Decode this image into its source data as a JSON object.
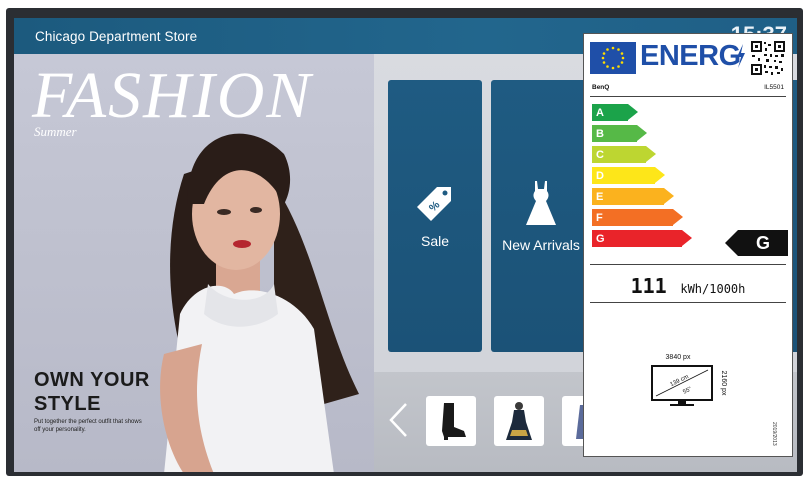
{
  "header": {
    "store_name": "Chicago Department Store",
    "clock": "15:37"
  },
  "hero": {
    "title": "FASHION",
    "subtitle": "Summer",
    "headline": "OWN YOUR STYLE",
    "description": "Put together the perfect outfit that shows off your personality."
  },
  "tiles": [
    {
      "label": "Sale",
      "icon": "price-tag-icon"
    },
    {
      "label": "New Arrivals",
      "icon": "dress-icon"
    }
  ],
  "thumbnails": [
    {
      "icon": "boot-icon"
    },
    {
      "icon": "dress-thumbnail-icon"
    },
    {
      "icon": "garment-icon"
    }
  ],
  "energy_label": {
    "logo_text": "ENERG",
    "supplier": "BenQ",
    "model": "IL5501",
    "classes": [
      {
        "letter": "A",
        "color": "#1ba34a"
      },
      {
        "letter": "B",
        "color": "#56b947"
      },
      {
        "letter": "C",
        "color": "#bdd631"
      },
      {
        "letter": "D",
        "color": "#fde619"
      },
      {
        "letter": "E",
        "color": "#fbb21e"
      },
      {
        "letter": "F",
        "color": "#f36f24"
      },
      {
        "letter": "G",
        "color": "#e9242a"
      }
    ],
    "rating": "G",
    "consumption_value": "111",
    "consumption_unit": "kWh/1000h",
    "resolution_h": "3840 px",
    "resolution_v": "2160 px",
    "diagonal_cm": "139 cm",
    "diagonal_in": "55\"",
    "regulation": "2019/2013"
  }
}
